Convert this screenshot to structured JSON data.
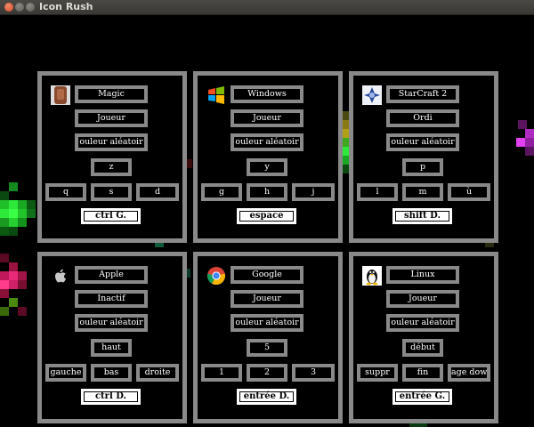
{
  "window": {
    "title": "Icon Rush"
  },
  "panels": [
    {
      "name": "magic",
      "icon": "magic-hand-icon",
      "player": "Magic",
      "type": "Joueur",
      "color": "ouleur aléatoir",
      "keys": [
        "z",
        "q",
        "s",
        "d"
      ],
      "control": "ctrl G."
    },
    {
      "name": "windows",
      "icon": "windows-logo-icon",
      "player": "Windows",
      "type": "Joueur",
      "color": "ouleur aléatoir",
      "keys": [
        "y",
        "g",
        "h",
        "j"
      ],
      "control": "espace"
    },
    {
      "name": "starcraft",
      "icon": "starcraft2-logo-icon",
      "player": "StarCraft 2",
      "type": "Ordi",
      "color": "ouleur aléatoir",
      "keys": [
        "p",
        "l",
        "m",
        "ù"
      ],
      "control": "shift D."
    },
    {
      "name": "apple",
      "icon": "apple-logo-icon",
      "player": "Apple",
      "type": "Inactif",
      "color": "ouleur aléatoir",
      "keys": [
        "haut",
        "gauche",
        "bas",
        "droite"
      ],
      "control": "ctrl D."
    },
    {
      "name": "google",
      "icon": "chrome-logo-icon",
      "player": "Google",
      "type": "Joueur",
      "color": "ouleur aléatoir",
      "keys": [
        "5",
        "1",
        "2",
        "3"
      ],
      "control": "entrée D."
    },
    {
      "name": "linux",
      "icon": "tux-penguin-icon",
      "player": "Linux",
      "type": "Joueur",
      "color": "ouleur aléatoir",
      "keys": [
        "début",
        "suppr",
        "fin",
        "age dow"
      ],
      "control": "entrée G."
    }
  ]
}
